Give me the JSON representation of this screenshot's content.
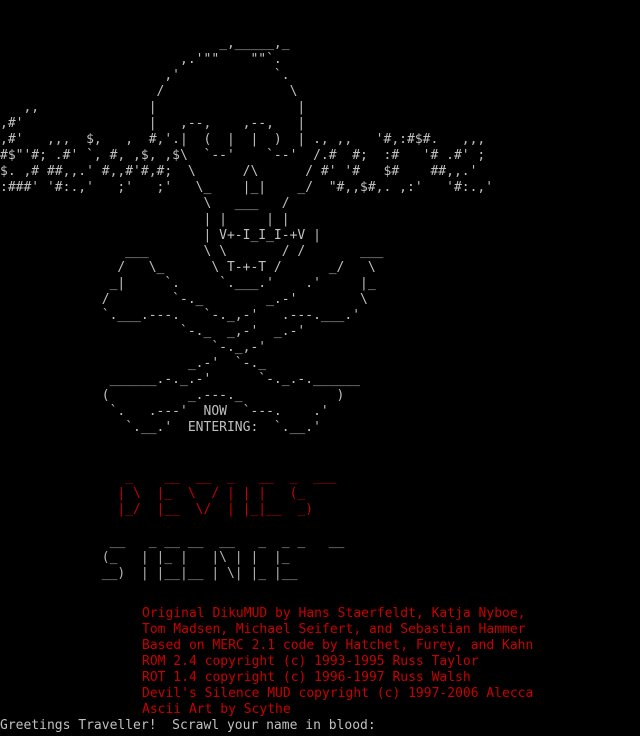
{
  "skull_art": [
    "                            _,_____,_",
    "                       ,.'\"\"    \"\"`.",
    "                     ,'            `.",
    "                    /                \\",
    "   ,,              |                  |",
    ",#'                |   ,--,    ,--,   |",
    ",#'   ,,,  $,   ,  #,'.|  (  |  |  )  | ., ,,   '#,:#$#.   ,,,",
    "#$\"'#; .#' `, #, ,$, ,$\\  `--'    `--'  /.#  #;  :#   '# .#' ;",
    "$. ,# ##,,.' #,,#'#,#;  \\      /\\      / #' '#   $#    ##,,.'",
    ":###' '#:.,'   ;'   ;'   \\_    |_|    _/  \"#,,$#,. ,:'   '#:.,'",
    "                          \\   ___   /",
    "                          | |     | |",
    "                          | V+-I_I_I-+V |",
    "                ___       \\ \\       / /       ___",
    "               /   \\_      \\ T-+-T /      _/   \\",
    "              _|     `.     `.___.'    .'     |_",
    "             /        `-._        _.-'        \\",
    "             `.___.---.   `-._,-'   .---.___.'",
    "                       `-._  _,-'  _.-'",
    "                           `-._,-'",
    "                        _.-'  `-._",
    "              ______.-._.-'      `-._.-.______",
    "             (          _.---._            )",
    "              `.   .---'  NOW  `---.    .'",
    "                `.__.'  ENTERING:  `.__.'"
  ],
  "title_art": [
    "                _    __  __  _   __  _  ___",
    "               | \\  |_  \\  / | | |   (_ ",
    "               |_/  |__  \\/  | |_|__  _)"
  ],
  "subtitle_art": [
    "              __   _ __ __  __   _  _ _   __",
    "             (_   | |_ |   |\\ | |  |_",
    "             __)  | |__|__ | \\| |_ |__"
  ],
  "credits": [
    "Original DikuMUD by Hans Staerfeldt, Katja Nyboe,",
    "Tom Madsen, Michael Seifert, and Sebastian Hammer",
    "Based on MERC 2.1 code by Hatchet, Furey, and Kahn",
    "ROM 2.4 copyright (c) 1993-1995 Russ Taylor",
    "ROT 1.4 copyright (c) 1996-1997 Russ Walsh",
    "Devil's Silence MUD copyright (c) 1997-2006 Alecca",
    "Ascii Art by Scythe"
  ],
  "prompt": {
    "text": "Greetings Traveller!  Scrawl your name in blood: ",
    "value": ""
  },
  "colors": {
    "background": "#000000",
    "text": "#c0c0c0",
    "red": "#c80000",
    "grey": "#b4b4b4"
  }
}
